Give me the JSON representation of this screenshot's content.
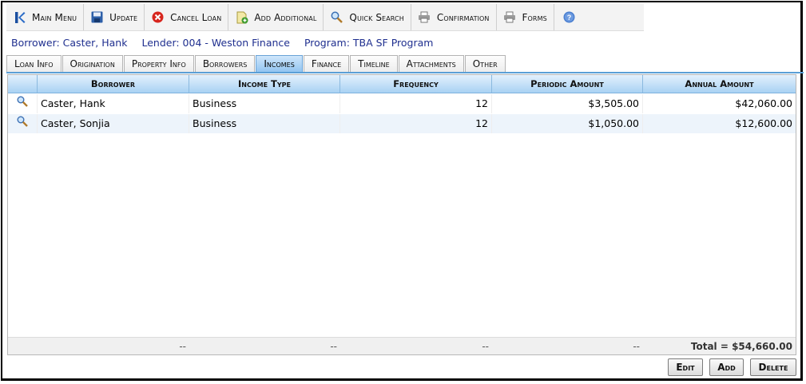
{
  "toolbar": {
    "buttons": [
      {
        "label": "Main Menu",
        "icon": "main-menu-icon"
      },
      {
        "label": "Update",
        "icon": "save-icon"
      },
      {
        "label": "Cancel Loan",
        "icon": "cancel-icon"
      },
      {
        "label": "Add Additional",
        "icon": "add-additional-icon"
      },
      {
        "label": "Quick Search",
        "icon": "search-icon"
      },
      {
        "label": "Confirmation",
        "icon": "printer-icon"
      },
      {
        "label": "Forms",
        "icon": "printer-icon"
      }
    ],
    "help_icon": "help-icon"
  },
  "info": {
    "borrower": "Borrower: Caster, Hank",
    "lender": "Lender: 004 - Weston Finance",
    "program": "Program: TBA SF Program"
  },
  "tabs": [
    "Loan Info",
    "Origination",
    "Property Info",
    "Borrowers",
    "Incomes",
    "Finance",
    "Timeline",
    "Attachments",
    "Other"
  ],
  "active_tab": "Incomes",
  "grid": {
    "columns": [
      "Borrower",
      "Income Type",
      "Frequency",
      "Periodic Amount",
      "Annual Amount"
    ],
    "rows": [
      {
        "borrower": "Caster, Hank",
        "income_type": "Business",
        "frequency": "12",
        "periodic_amount": "$3,505.00",
        "annual_amount": "$42,060.00"
      },
      {
        "borrower": "Caster, Sonjia",
        "income_type": "Business",
        "frequency": "12",
        "periodic_amount": "$1,050.00",
        "annual_amount": "$12,600.00"
      }
    ],
    "footer": {
      "col1": "--",
      "col2": "--",
      "col3": "--",
      "col4": "--",
      "total": "Total = $54,660.00"
    }
  },
  "actions": {
    "edit": "Edit",
    "add": "Add",
    "delete": "Delete"
  },
  "colors": {
    "accent": "#5a9fd6",
    "info_text": "#1f2f8f",
    "active_tab": "#8fc3f0"
  }
}
